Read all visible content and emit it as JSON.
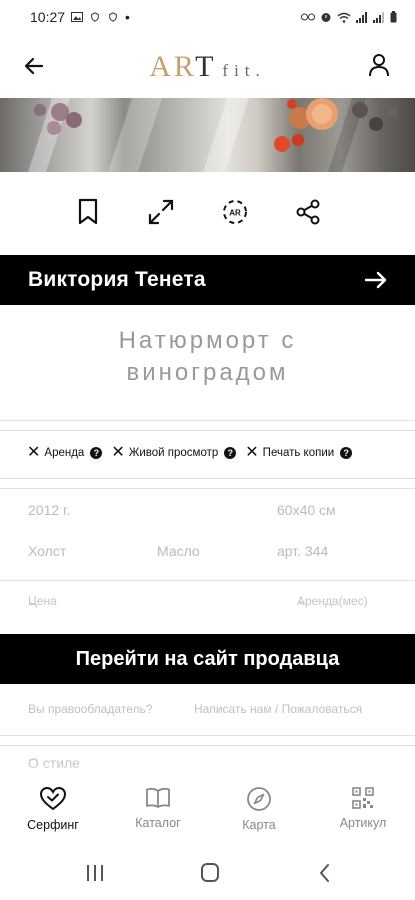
{
  "status_bar": {
    "time": "10:27",
    "dot": "•"
  },
  "header": {
    "logo_main_accent": "AR",
    "logo_main_dark": "T",
    "logo_sub": "fit."
  },
  "artwork": {
    "icons": [
      "bookmark-icon",
      "fullscreen-icon",
      "ar-view-icon",
      "share-icon"
    ]
  },
  "artist": {
    "name": "Виктория Тенета"
  },
  "title": {
    "line1": "Натюрморт с",
    "line2": "виноградом"
  },
  "options": [
    {
      "label": "Аренда"
    },
    {
      "label": "Живой просмотр"
    },
    {
      "label": "Печать копии"
    }
  ],
  "details": {
    "year": "2012 г.",
    "size": "60x40 см",
    "material": "Холст",
    "technique": "Масло",
    "article": "арт. 344"
  },
  "filters": {
    "price": "Цена",
    "rent": "Аренда(мес)"
  },
  "seller_button": "Перейти на сайт продавца",
  "owner": {
    "question": "Вы правообладатель?",
    "action": "Написать нам / Пожаловаться"
  },
  "style_peek": "О стиле",
  "tabs": [
    {
      "label": "Серфинг",
      "icon": "heart-check-icon",
      "active": true
    },
    {
      "label": "Каталог",
      "icon": "book-icon",
      "active": false
    },
    {
      "label": "Карта",
      "icon": "compass-icon",
      "active": false
    },
    {
      "label": "Артикул",
      "icon": "qr-code-icon",
      "active": false
    }
  ],
  "colors": {
    "logo_accent": "#c7a070",
    "bar_bg": "#000000",
    "muted": "#bbbbbb"
  }
}
